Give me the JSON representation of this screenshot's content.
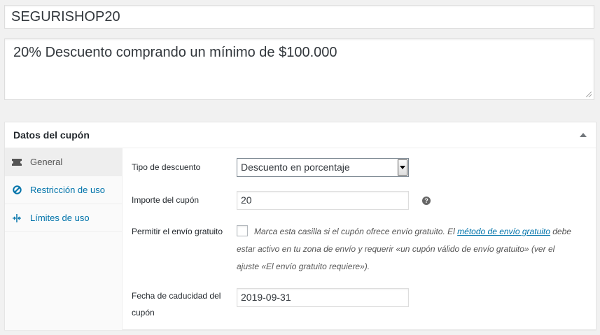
{
  "coupon": {
    "code": "SEGURISHOP20",
    "description": "20% Descuento comprando un mínimo de $100.000"
  },
  "metabox": {
    "title": "Datos del cupón",
    "tabs": [
      {
        "label": "General",
        "icon": "ticket-icon",
        "active": true
      },
      {
        "label": "Restricción de uso",
        "icon": "no-entry-icon",
        "active": false
      },
      {
        "label": "Límites de uso",
        "icon": "limits-icon",
        "active": false
      }
    ]
  },
  "general": {
    "discount_type_label": "Tipo de descuento",
    "discount_type_value": "Descuento en porcentaje",
    "amount_label": "Importe del cupón",
    "amount_value": "20",
    "free_shipping_label": "Permitir el envío gratuito",
    "free_shipping_text_1": "Marca esta casilla si el cupón ofrece envío gratuito. El ",
    "free_shipping_link": "método de envío gratuito",
    "free_shipping_text_2": " debe estar activo en tu zona de envío y requerir «un cupón válido de envío gratuito» (ver el ajuste «El envío gratuito requiere»).",
    "expiry_label": "Fecha de caducidad del cupón",
    "expiry_value": "2019-09-31"
  },
  "colors": {
    "link": "#0073aa",
    "background": "#f1f1f1"
  }
}
